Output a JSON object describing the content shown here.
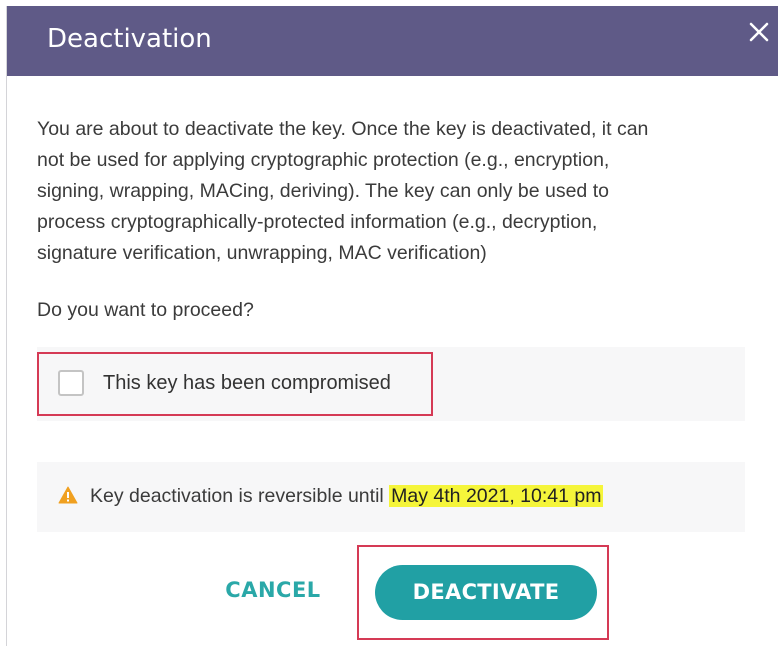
{
  "dialog": {
    "title": "Deactivation",
    "close_icon": "close-icon",
    "header_color": "#5f5a87",
    "message_lines": [
      "You are about to deactivate the key. Once the key is deactivated, it can",
      "not be used for applying cryptographic protection (e.g., encryption,",
      "signing, wrapping, MACing, deriving). The key can only be used to",
      "process cryptographically-protected information (e.g., decryption,",
      "signature verification, unwrapping, MAC verification)"
    ],
    "question": "Do you want to proceed?",
    "compromised_checkbox": {
      "label": "This key has been compromised",
      "checked": false
    },
    "warning": {
      "icon": "warning-triangle-icon",
      "icon_color": "#f0a020",
      "text": "Key deactivation is reversible until",
      "date": "May 4th 2021, 10:41 pm",
      "highlight_color": "#f5f53a"
    },
    "buttons": {
      "cancel_label": "CANCEL",
      "deactivate_label": "DEACTIVATE",
      "accent_color": "#21a0a4"
    },
    "annotation_color": "#d53a55"
  }
}
